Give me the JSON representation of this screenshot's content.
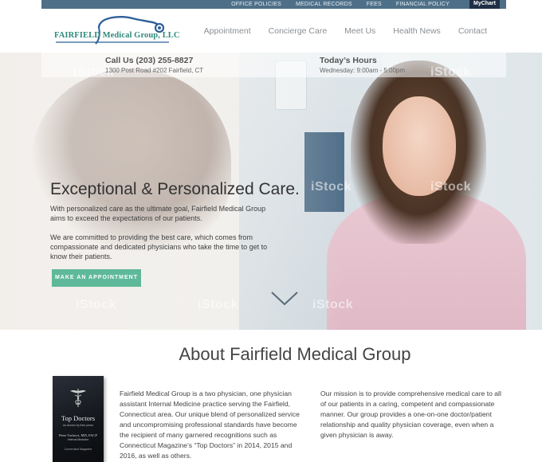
{
  "topbar": {
    "links": [
      "OFFICE POLICIES",
      "MEDICAL RECORDS",
      "FEES",
      "FINANCIAL POLICY"
    ],
    "mychart_label": "MyChart"
  },
  "header": {
    "logo_text": "FAIRFIELD Medical Group, LLC",
    "nav": [
      "Appointment",
      "Concierge Care",
      "Meet Us",
      "Health News",
      "Contact"
    ]
  },
  "hero": {
    "call": {
      "title": "Call Us (203) 255-8827",
      "address": "1300 Post Road #202 Fairfield, CT"
    },
    "hours": {
      "title": "Today’s Hours",
      "value": "Wednesday: 9:00am - 5:00pm"
    },
    "headline": "Exceptional & Personalized Care.",
    "paragraph1": "With personalized care as the ultimate goal, Fairfield Medical Group aims to exceed the expectations of our patients.",
    "paragraph2": "We are committed to providing the best care, which comes from compassionate and dedicated physicians who take the time to get to know their patients.",
    "cta_label": "MAKE AN APPOINTMENT",
    "watermark": "iStock"
  },
  "about": {
    "title": "About Fairfield Medical Group",
    "column1": "Fairfield Medical Group is a two physician, one physician assistant Internal Medicine practice serving the Fairfield, Connecticut area. Our unique blend of personalized service and uncompromising professional standards have become the recipient of many garnered recognitions such as Connecticut Magazine’s “Top Doctors” in 2014, 2015 and 2016, as well as others.",
    "column2": "Our mission is to provide comprehensive medical care to all of our patients in a caring, competent and compassionate manner. Our group provides a one-on-one doctor/patient relationship and quality physician coverage, even when a given physician is away.",
    "plaque": {
      "title": "Top Doctors",
      "subtitle": "as chosen by their peers",
      "name": "Peter Torlucci, MD, FACP",
      "role": "Internal Medicine",
      "footer": "Connecticut Magazine"
    }
  },
  "colors": {
    "topbar": "#4e6f88",
    "mychart": "#1f2f45",
    "logo_green": "#2f8a7c",
    "logo_blue": "#2f5f98",
    "cta": "#5eb99a"
  }
}
